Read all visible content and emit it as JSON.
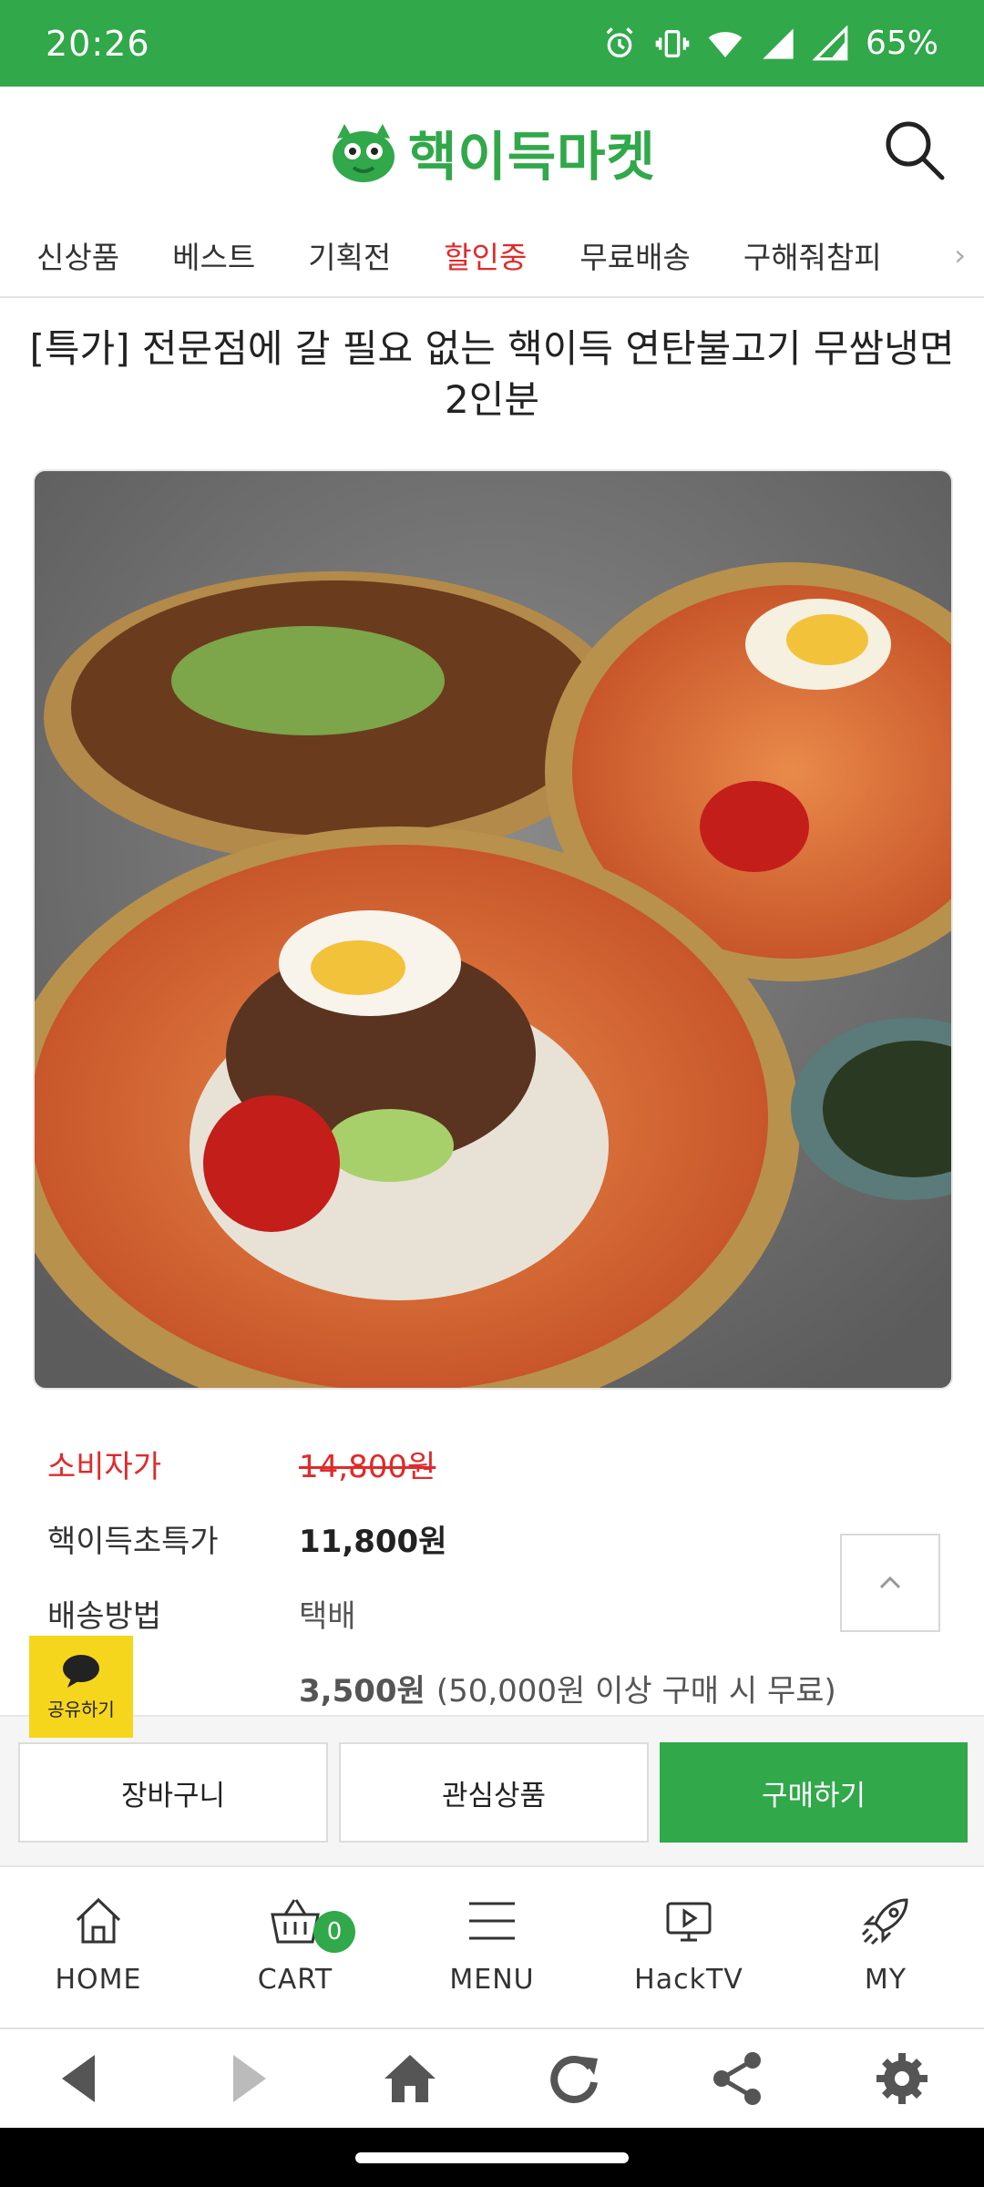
{
  "status_bar": {
    "time": "20:26",
    "battery": "65%",
    "icons": [
      "alarm-icon",
      "vibrate-icon",
      "wifi-icon",
      "signal-icon",
      "signal-icon",
      "battery-icon"
    ]
  },
  "header": {
    "logo_text": "핵이득마켓",
    "search_icon": "search-icon",
    "brand_color": "#31a84a"
  },
  "categories": [
    {
      "label": "신상품",
      "active": false
    },
    {
      "label": "베스트",
      "active": false
    },
    {
      "label": "기획전",
      "active": false
    },
    {
      "label": "할인중",
      "active": true
    },
    {
      "label": "무료배송",
      "active": false
    },
    {
      "label": "구해줘참피",
      "active": false
    }
  ],
  "product": {
    "title": "[특가] 전문점에 갈 필요 없는 핵이득 연탄불고기 무쌈냉면 2인분",
    "consumer_price_label": "소비자가",
    "consumer_price": "14,800원",
    "special_price_label": "핵이득초특가",
    "special_price": "11,800원",
    "shipping_method_label": "배송방법",
    "shipping_method": "택배",
    "shipping_fee": "3,500원",
    "shipping_fee_note": "(50,000원 이상 구매 시 무료)"
  },
  "share": {
    "label": "공유하기"
  },
  "actions": {
    "cart": "장바구니",
    "wishlist": "관심상품",
    "buy": "구매하기"
  },
  "tabbar": {
    "items": [
      {
        "label": "HOME",
        "icon": "home-icon"
      },
      {
        "label": "CART",
        "icon": "cart-icon",
        "badge": "0"
      },
      {
        "label": "MENU",
        "icon": "menu-icon"
      },
      {
        "label": "HackTV",
        "icon": "tv-icon"
      },
      {
        "label": "MY",
        "icon": "rocket-icon"
      }
    ]
  },
  "browser_bar": {
    "icons": [
      "back-icon",
      "forward-icon",
      "home-icon",
      "refresh-icon",
      "share-icon",
      "settings-icon"
    ]
  }
}
